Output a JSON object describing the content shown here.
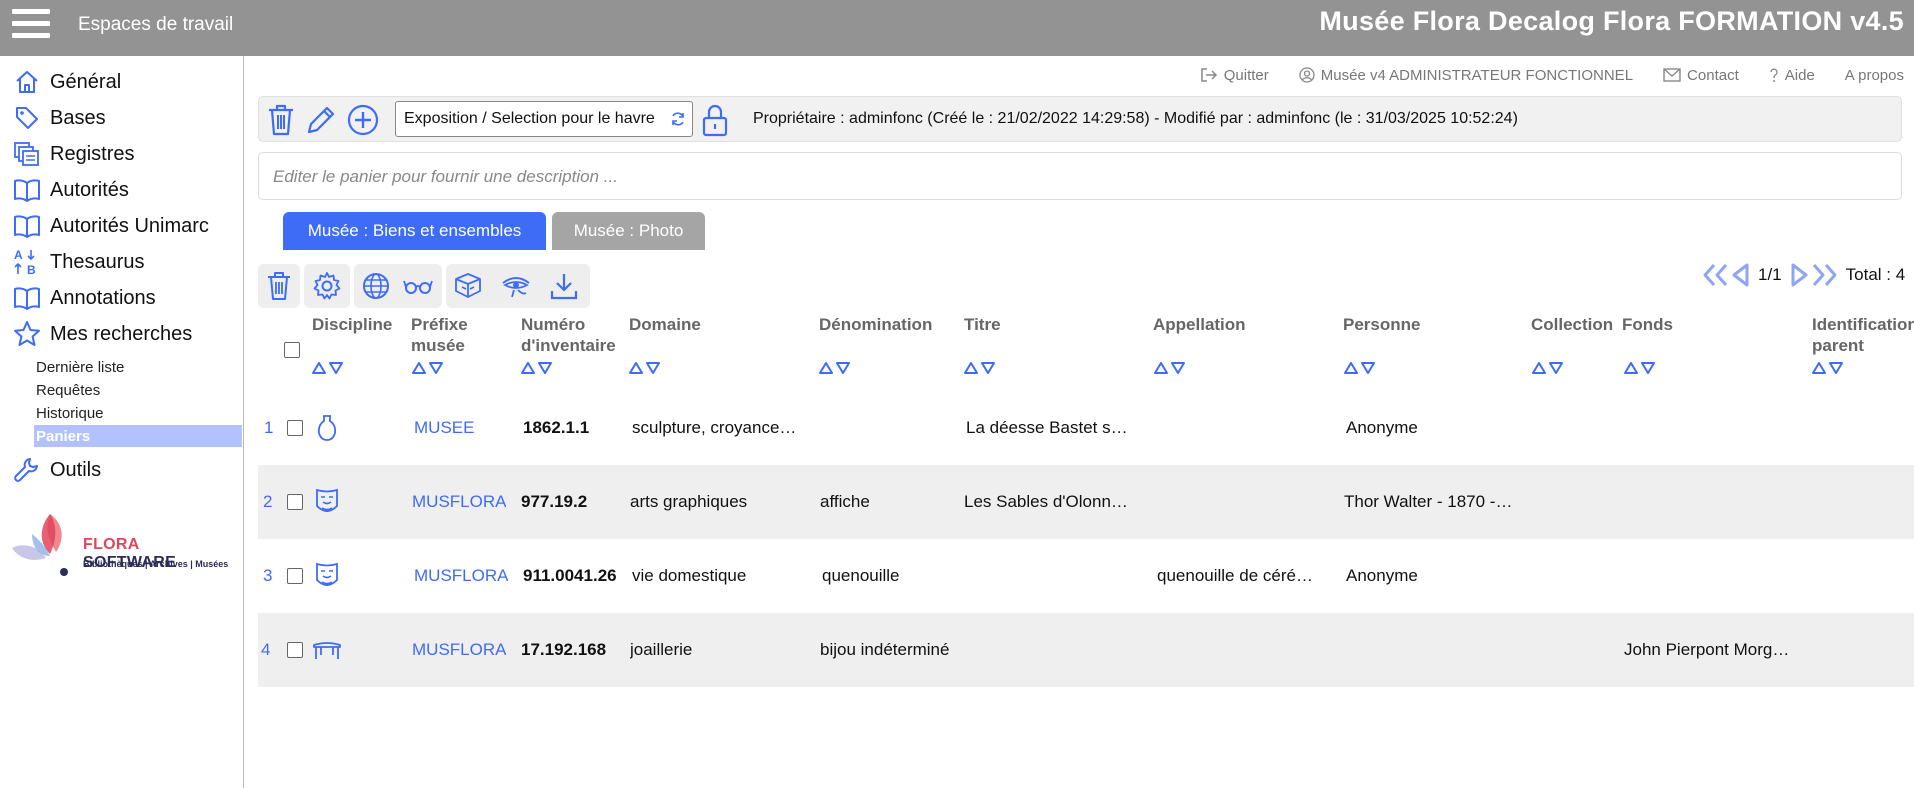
{
  "header": {
    "workspaces_label": "Espaces de travail",
    "app_title": "Musée Flora Decalog Flora FORMATION v4.5"
  },
  "sidebar": {
    "items": [
      {
        "label": "Général",
        "icon": "home-icon"
      },
      {
        "label": "Bases",
        "icon": "tag-icon"
      },
      {
        "label": "Registres",
        "icon": "registers-icon"
      },
      {
        "label": "Autorités",
        "icon": "book-icon"
      },
      {
        "label": "Autorités Unimarc",
        "icon": "book-icon"
      },
      {
        "label": "Thesaurus",
        "icon": "sort-alpha-icon"
      },
      {
        "label": "Annotations",
        "icon": "book-icon"
      },
      {
        "label": "Mes recherches",
        "icon": "star-icon"
      }
    ],
    "sub_items": [
      "Dernière liste",
      "Requêtes",
      "Historique",
      "Paniers"
    ],
    "active_sub_item": "Paniers",
    "tools_label": "Outils",
    "logo": {
      "brand_part1": "FLORA",
      "brand_part2": " SOFTWARE",
      "tagline": "Bibliothèques | Archives | Musées"
    }
  },
  "top_links": [
    {
      "label": "Quitter",
      "icon": "logout-icon"
    },
    {
      "label": "Musée v4 ADMINISTRATEUR FONCTIONNEL",
      "icon": "user-circle-icon"
    },
    {
      "label": "Contact",
      "icon": "mail-icon"
    },
    {
      "label": "Aide",
      "icon": "help-icon"
    },
    {
      "label": "A propos",
      "icon": ""
    }
  ],
  "basket": {
    "selected": "Exposition / Selection pour le havre",
    "owner_info": "Propriétaire : adminfonc (Créé le : 21/02/2022 14:29:58) - Modifié par : adminfonc (le : 31/03/2025 10:52:24)",
    "description_placeholder": "Editer le panier pour fournir une description ..."
  },
  "tabs": [
    {
      "label": "Musée : Biens et ensembles",
      "active": true
    },
    {
      "label": "Musée : Photo",
      "active": false
    }
  ],
  "pager": {
    "page": "1/1",
    "total": "Total : 4"
  },
  "columns": {
    "discipline": "Discipline",
    "prefix": "Préfixe musée",
    "inventory": "Numéro d'inventaire",
    "domain": "Domaine",
    "denomination": "Dénomination",
    "title": "Titre",
    "appellation": "Appellation",
    "person": "Personne",
    "collection": "Collection",
    "fonds": "Fonds",
    "parent": "Identification parent"
  },
  "rows": [
    {
      "n": "1",
      "discipline_icon": "vase-icon",
      "prefix": "MUSEE",
      "inventory": "1862.1.1",
      "domain": "sculpture, croyance…",
      "denomination": "",
      "title": "La déesse Bastet s…",
      "appellation": "",
      "person": "Anonyme",
      "collection": "",
      "fonds": "",
      "parent": ""
    },
    {
      "n": "2",
      "discipline_icon": "ethnography-icon",
      "prefix": "MUSFLORA",
      "inventory": "977.19.2",
      "domain": "arts graphiques",
      "denomination": "affiche",
      "title": "Les Sables d'Olonn…",
      "appellation": "",
      "person": "Thor Walter - 1870 -…",
      "collection": "",
      "fonds": "",
      "parent": ""
    },
    {
      "n": "3",
      "discipline_icon": "ethnography-icon",
      "prefix": "MUSFLORA",
      "inventory": "911.0041.26",
      "domain": "vie domestique",
      "denomination": "quenouille",
      "title": "",
      "appellation": "quenouille de céré…",
      "person": "Anonyme",
      "collection": "",
      "fonds": "",
      "parent": ""
    },
    {
      "n": "4",
      "discipline_icon": "furniture-icon",
      "prefix": "MUSFLORA",
      "inventory": "17.192.168",
      "domain": "joaillerie",
      "denomination": "bijou indéterminé",
      "title": "",
      "appellation": "",
      "person": "",
      "collection": "",
      "fonds": "John Pierpont Morg…",
      "parent": ""
    }
  ]
}
